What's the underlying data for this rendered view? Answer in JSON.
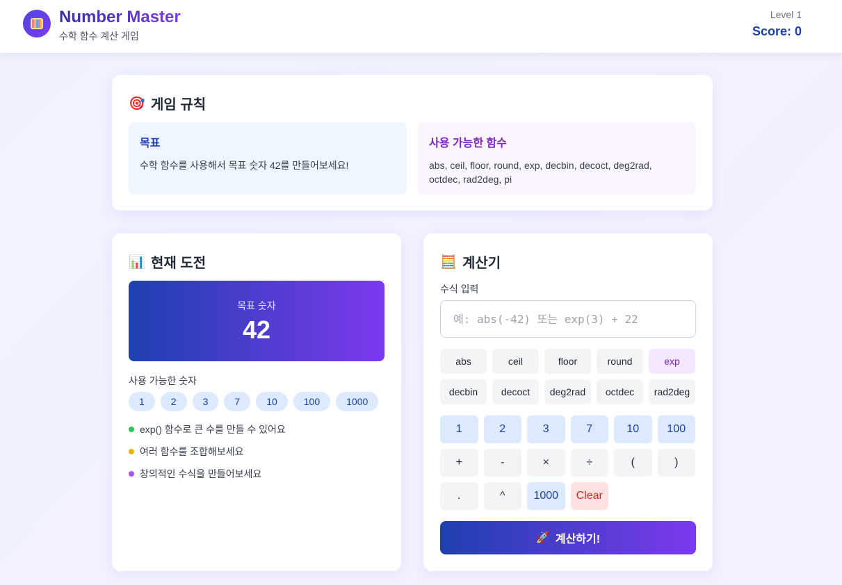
{
  "header": {
    "title": "Number Master",
    "subtitle": "수학 함수 계산 게임",
    "level": "Level 1",
    "score": "Score: 0"
  },
  "rules": {
    "icon": "🎯",
    "title": "게임 규칙",
    "goal_title": "목표",
    "goal_text": "수학 함수를 사용해서 목표 숫자 42를 만들어보세요!",
    "funcs_title": "사용 가능한 함수",
    "funcs_text": "abs, ceil, floor, round, exp, decbin, decoct, deg2rad, octdec, rad2deg, pi"
  },
  "challenge": {
    "icon": "📊",
    "title": "현재 도전",
    "target_label": "목표 숫자",
    "target_value": "42",
    "available_label": "사용 가능한 숫자",
    "numbers": [
      "1",
      "2",
      "3",
      "7",
      "10",
      "100",
      "1000"
    ],
    "tips": [
      {
        "text": "exp() 함수로 큰 수를 만들 수 있어요",
        "color": "#22c55e"
      },
      {
        "text": "여러 함수를 조합해보세요",
        "color": "#eab308"
      },
      {
        "text": "창의적인 수식을 만들어보세요",
        "color": "#a855f7"
      }
    ]
  },
  "calculator": {
    "icon": "🧮",
    "title": "계산기",
    "input_label": "수식 입력",
    "input_value": "",
    "input_placeholder": "예: abs(-42) 또는 exp(3) + 22",
    "functions": [
      "abs",
      "ceil",
      "floor",
      "round",
      "exp",
      "decbin",
      "decoct",
      "deg2rad",
      "octdec",
      "rad2deg"
    ],
    "active_function": "exp",
    "keys": [
      {
        "label": "1",
        "kind": "num"
      },
      {
        "label": "2",
        "kind": "num"
      },
      {
        "label": "3",
        "kind": "num"
      },
      {
        "label": "7",
        "kind": "num"
      },
      {
        "label": "10",
        "kind": "num"
      },
      {
        "label": "100",
        "kind": "num"
      },
      {
        "label": "+",
        "kind": "op"
      },
      {
        "label": "-",
        "kind": "op"
      },
      {
        "label": "×",
        "kind": "op"
      },
      {
        "label": "÷",
        "kind": "op"
      },
      {
        "label": "(",
        "kind": "op"
      },
      {
        "label": ")",
        "kind": "op"
      },
      {
        "label": ".",
        "kind": "op"
      },
      {
        "label": "^",
        "kind": "op"
      },
      {
        "label": "1000",
        "kind": "num"
      },
      {
        "label": "Clear",
        "kind": "clear"
      }
    ],
    "submit_icon": "🚀",
    "submit_label": "계산하기!"
  }
}
